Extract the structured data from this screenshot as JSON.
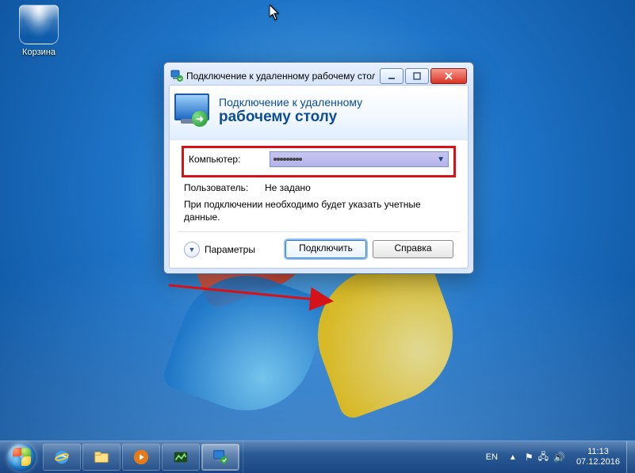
{
  "desktop": {
    "recycle_bin_label": "Корзина"
  },
  "window": {
    "title": "Подключение к удаленному рабочему столу",
    "banner_line1": "Подключение к удаленному",
    "banner_line2": "рабочему столу",
    "computer_label": "Компьютер:",
    "computer_value": "",
    "user_label": "Пользователь:",
    "user_value": "Не задано",
    "hint": "При подключении необходимо будет указать учетные данные.",
    "options_label": "Параметры",
    "connect_label": "Подключить",
    "help_label": "Справка"
  },
  "taskbar": {
    "language": "EN",
    "time": "11:13",
    "date": "07.12.2016"
  },
  "annotation": {
    "highlight_field": "computer",
    "arrow_target": "connect-button"
  }
}
